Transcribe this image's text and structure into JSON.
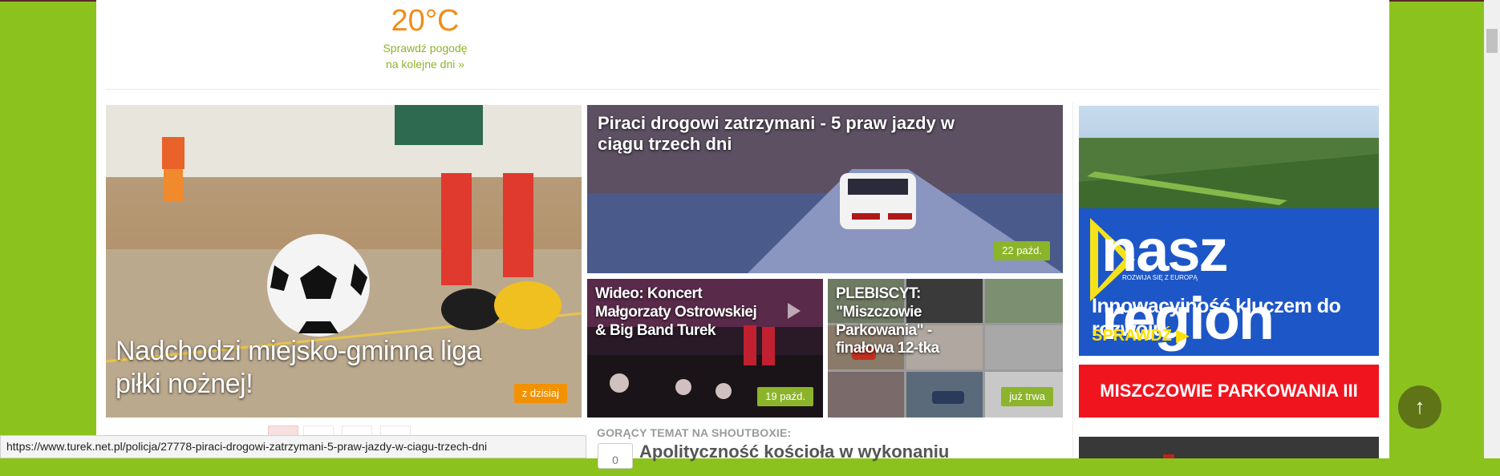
{
  "weather": {
    "temperature": "20°C",
    "link_line1": "Sprawdź pogodę",
    "link_line2": "na kolejne dni »"
  },
  "featured": [
    {
      "title": "Nadchodzi miejsko-gminna liga piłki nożnej!",
      "date": "z dzisiaj",
      "badge_color": "#f39200"
    },
    {
      "title": "Piraci drogowi zatrzymani - 5 praw jazdy w ciągu trzech dni",
      "date": "22 paźd.",
      "badge_color": "#8cb42a"
    },
    {
      "title": "Wideo: Koncert Małgorzaty Ostrowskiej & Big Band Turek",
      "date": "19 paźd.",
      "badge_color": "#8cb42a"
    },
    {
      "title": "PLEBISCYT: \"Miszczowie Parkowania\" - finałowa 12-tka",
      "date": "już trwa",
      "badge_color": "#8cb42a"
    }
  ],
  "ads": {
    "nasz_region": {
      "brand": "nasz region",
      "subtitle": "ROZWIJA SIĘ Z EUROPĄ",
      "tagline": "Innowacyjność kluczem do rozwoju",
      "cta": "SPRAWDŹ ▶"
    },
    "miszczowie": "MISZCZOWIE PARKOWANIA III"
  },
  "hot_topic": {
    "label": "GORĄCY TEMAT NA SHOUTBOXIE:",
    "count": "0",
    "title": "Apolityczność kościoła w wykonaniu"
  },
  "status_url": "https://www.turek.net.pl/policja/27778-piraci-drogowi-zatrzymani-5-praw-jazdy-w-ciagu-trzech-dni",
  "scroll_top_icon": "arrow-up-icon",
  "colors": {
    "site_green": "#8cc21e",
    "accent_orange": "#f39200",
    "badge_green": "#8cb42a"
  }
}
